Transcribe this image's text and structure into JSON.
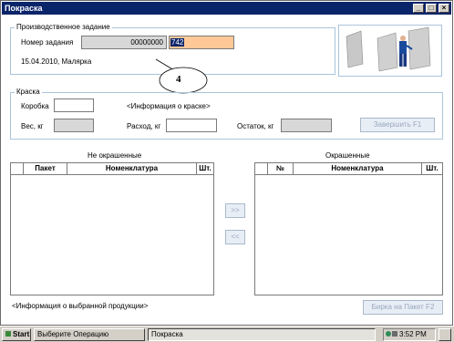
{
  "window": {
    "title": "Покраска"
  },
  "production": {
    "group_label": "Производственное задание",
    "order_label": "Номер задания",
    "order_number": "00000000",
    "order_input": "742",
    "info_line": "15.04.2010, Малярка"
  },
  "callout": {
    "number": "4"
  },
  "paint": {
    "group_label": "Краска",
    "box_label": "Коробка",
    "paint_info": "<Информация о краске>",
    "weight_label": "Вес, кг",
    "consumption_label": "Расход, кг",
    "remainder_label": "Остаток, кг",
    "finish_button": "Завершить     F1"
  },
  "unpainted": {
    "title": "Не окрашенные",
    "columns": [
      "Пакет",
      "Номенклатура",
      "Шт."
    ]
  },
  "painted": {
    "title": "Окрашенные",
    "columns": [
      "№",
      "Номенклатура",
      "Шт."
    ]
  },
  "transfer": {
    "forward": ">>",
    "back": "<<"
  },
  "footer": {
    "product_info": "<Информация о выбранной продукции>",
    "tag_button": "Бирка на Пакет   F2"
  },
  "taskbar": {
    "start": "Start",
    "item1": "Выберите Операцию",
    "item2": "Покраска",
    "clock": "3:52 PM"
  },
  "colors": {
    "titlebar": "#0a246a",
    "input_highlight": "#ffc896",
    "group_border": "#a9c4dc"
  }
}
